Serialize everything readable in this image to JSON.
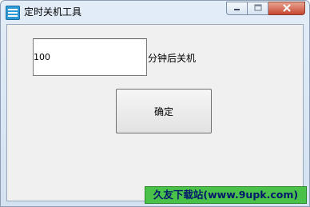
{
  "window": {
    "title": "定时关机工具",
    "icon": "app-clock-icon",
    "controls": {
      "minimize": "minimize-icon",
      "maximize": "maximize-icon",
      "close": "close-icon"
    }
  },
  "form": {
    "minutes_value": "100",
    "minutes_suffix": "分钟后关机",
    "ok_label": "确定"
  },
  "watermark": {
    "text": "久友下载站(www.9upk.com)"
  },
  "colors": {
    "watermark_bg": "#4ac24a",
    "watermark_text": "#00186b"
  }
}
